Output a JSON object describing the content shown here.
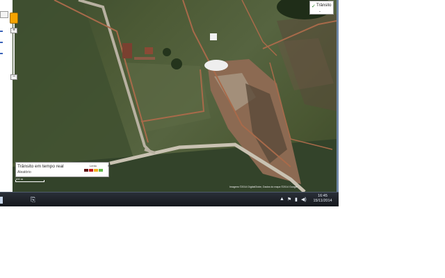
{
  "map": {
    "traffic_toggle_label": "Trânsito",
    "traffic_toggle_sub": "-",
    "zoom_in": "+",
    "zoom_out": "−",
    "copyright": "Imagens ©2014 DigitalGlobe, Dados do mapa ©2014 Google"
  },
  "legend": {
    "title": "Trânsito em tempo real",
    "subtitle": "Aleatório",
    "slow_label": "Lento",
    "fast_label": "Rápido",
    "colors": [
      "#5a0c0c",
      "#c31d1d",
      "#f2b01e",
      "#62b84a"
    ]
  },
  "scale": {
    "label": "100 m"
  },
  "taskbar": {
    "tray": {
      "arrow": "▲",
      "flag": "⚑",
      "network": "▮",
      "volume": "◀)"
    },
    "clock": {
      "time": "16:45",
      "date": "15/11/2014"
    }
  },
  "colors": {
    "map_green": "#4c5a35",
    "road": "#b8b1a1",
    "dirt": "#a86a4a",
    "taskbar": "#1b1f25"
  }
}
